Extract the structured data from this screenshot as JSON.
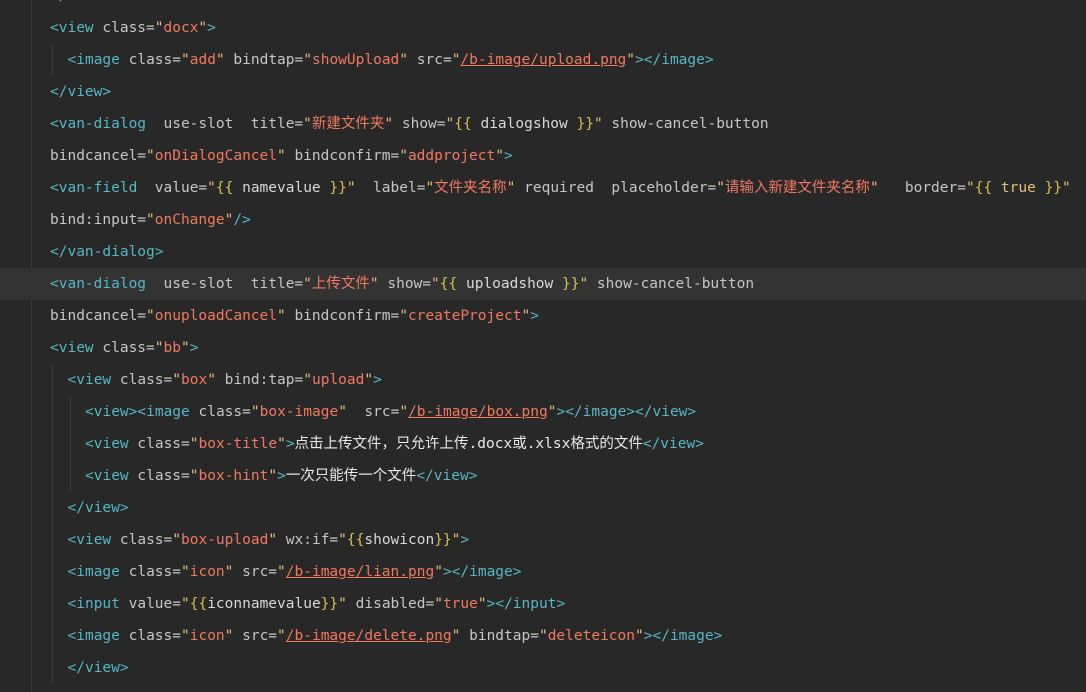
{
  "lines": [
    {
      "indent": 1,
      "tokens": [
        [
          "tag",
          "</view>"
        ]
      ]
    },
    {
      "indent": 1,
      "tokens": [
        [
          "tag",
          "<view"
        ],
        [
          "attr",
          " class="
        ],
        [
          "str",
          "\""
        ],
        [
          "val",
          "docx"
        ],
        [
          "str",
          "\""
        ],
        [
          "tag",
          ">"
        ]
      ]
    },
    {
      "indent": 2,
      "tokens": [
        [
          "tag",
          "<image"
        ],
        [
          "attr",
          " class="
        ],
        [
          "str",
          "\""
        ],
        [
          "val",
          "add"
        ],
        [
          "str",
          "\""
        ],
        [
          "attr",
          " bindtap="
        ],
        [
          "str",
          "\""
        ],
        [
          "val",
          "showUpload"
        ],
        [
          "str",
          "\""
        ],
        [
          "attr",
          " src="
        ],
        [
          "str",
          "\""
        ],
        [
          "link",
          "/b-image/upload.png"
        ],
        [
          "str",
          "\""
        ],
        [
          "tag",
          "></image>"
        ]
      ]
    },
    {
      "indent": 1,
      "tokens": [
        [
          "tag",
          "</view>"
        ]
      ]
    },
    {
      "indent": 1,
      "tokens": [
        [
          "tag",
          "<van-dialog"
        ],
        [
          "attr",
          "  use-slot  title="
        ],
        [
          "str",
          "\""
        ],
        [
          "val",
          "新建文件夹"
        ],
        [
          "str",
          "\""
        ],
        [
          "attr",
          " show="
        ],
        [
          "str",
          "\""
        ],
        [
          "brace",
          "{{"
        ],
        [
          "plain",
          " dialogshow "
        ],
        [
          "brace",
          "}}"
        ],
        [
          "str",
          "\""
        ],
        [
          "attr",
          " show-cancel-button"
        ]
      ]
    },
    {
      "indent": 1,
      "tokens": [
        [
          "attr",
          "bindcancel="
        ],
        [
          "str",
          "\""
        ],
        [
          "val",
          "onDialogCancel"
        ],
        [
          "str",
          "\""
        ],
        [
          "attr",
          " bindconfirm="
        ],
        [
          "str",
          "\""
        ],
        [
          "val",
          "addproject"
        ],
        [
          "str",
          "\""
        ],
        [
          "tag",
          ">"
        ]
      ]
    },
    {
      "indent": 1,
      "tokens": [
        [
          "tag",
          "<van-field"
        ],
        [
          "attr",
          "  value="
        ],
        [
          "str",
          "\""
        ],
        [
          "brace",
          "{{"
        ],
        [
          "plain",
          " namevalue "
        ],
        [
          "brace",
          "}}"
        ],
        [
          "str",
          "\""
        ],
        [
          "attr",
          "  label="
        ],
        [
          "str",
          "\""
        ],
        [
          "val",
          "文件夹名称"
        ],
        [
          "str",
          "\""
        ],
        [
          "attr",
          " required  placeholder="
        ],
        [
          "str",
          "\""
        ],
        [
          "val",
          "请输入新建文件夹名称"
        ],
        [
          "str",
          "\""
        ],
        [
          "attr",
          "   border="
        ],
        [
          "str",
          "\""
        ],
        [
          "brace",
          "{{"
        ],
        [
          "kw",
          " true "
        ],
        [
          "brace",
          "}}"
        ],
        [
          "str",
          "\""
        ]
      ]
    },
    {
      "indent": 1,
      "tokens": [
        [
          "attr",
          "bind:input="
        ],
        [
          "str",
          "\""
        ],
        [
          "val",
          "onChange"
        ],
        [
          "str",
          "\""
        ],
        [
          "tag",
          "/>"
        ]
      ]
    },
    {
      "indent": 1,
      "tokens": [
        [
          "tag",
          "</van-dialog>"
        ]
      ]
    },
    {
      "indent": 1,
      "highlight": true,
      "tokens": [
        [
          "tag",
          "<van-dialog"
        ],
        [
          "attr",
          "  use-slot  title="
        ],
        [
          "str",
          "\""
        ],
        [
          "val",
          "上传文件"
        ],
        [
          "str",
          "\""
        ],
        [
          "attr",
          " show="
        ],
        [
          "str",
          "\""
        ],
        [
          "brace",
          "{{"
        ],
        [
          "plain",
          " uploadshow "
        ],
        [
          "brace",
          "}}"
        ],
        [
          "str",
          "\""
        ],
        [
          "attr",
          " show-cancel-button"
        ]
      ]
    },
    {
      "indent": 1,
      "tokens": [
        [
          "attr",
          "bindcancel="
        ],
        [
          "str",
          "\""
        ],
        [
          "val",
          "onuploadCancel"
        ],
        [
          "str",
          "\""
        ],
        [
          "attr",
          " bindconfirm="
        ],
        [
          "str",
          "\""
        ],
        [
          "val",
          "createProject"
        ],
        [
          "str",
          "\""
        ],
        [
          "tag",
          ">"
        ]
      ]
    },
    {
      "indent": 1,
      "tokens": [
        [
          "tag",
          "<view"
        ],
        [
          "attr",
          " class="
        ],
        [
          "str",
          "\""
        ],
        [
          "val",
          "bb"
        ],
        [
          "str",
          "\""
        ],
        [
          "tag",
          ">"
        ]
      ]
    },
    {
      "indent": 2,
      "tokens": [
        [
          "tag",
          "<view"
        ],
        [
          "attr",
          " class="
        ],
        [
          "str",
          "\""
        ],
        [
          "val",
          "box"
        ],
        [
          "str",
          "\""
        ],
        [
          "attr",
          " bind:tap="
        ],
        [
          "str",
          "\""
        ],
        [
          "val",
          "upload"
        ],
        [
          "str",
          "\""
        ],
        [
          "tag",
          ">"
        ]
      ]
    },
    {
      "indent": 3,
      "tokens": [
        [
          "tag",
          "<view><image"
        ],
        [
          "attr",
          " class="
        ],
        [
          "str",
          "\""
        ],
        [
          "val",
          "box-image"
        ],
        [
          "str",
          "\""
        ],
        [
          "attr",
          "  src="
        ],
        [
          "str",
          "\""
        ],
        [
          "link",
          "/b-image/box.png"
        ],
        [
          "str",
          "\""
        ],
        [
          "tag",
          "></image></view>"
        ]
      ]
    },
    {
      "indent": 3,
      "tokens": [
        [
          "tag",
          "<view"
        ],
        [
          "attr",
          " class="
        ],
        [
          "str",
          "\""
        ],
        [
          "val",
          "box-title"
        ],
        [
          "str",
          "\""
        ],
        [
          "tag",
          ">"
        ],
        [
          "ctext",
          "点击上传文件，只允许上传.docx或.xlsx格式的文件"
        ],
        [
          "tag",
          "</view>"
        ]
      ]
    },
    {
      "indent": 3,
      "tokens": [
        [
          "tag",
          "<view"
        ],
        [
          "attr",
          " class="
        ],
        [
          "str",
          "\""
        ],
        [
          "val",
          "box-hint"
        ],
        [
          "str",
          "\""
        ],
        [
          "tag",
          ">"
        ],
        [
          "ctext",
          "一次只能传一个文件"
        ],
        [
          "tag",
          "</view>"
        ]
      ]
    },
    {
      "indent": 2,
      "tokens": [
        [
          "tag",
          "</view>"
        ]
      ]
    },
    {
      "indent": 2,
      "tokens": [
        [
          "tag",
          "<view"
        ],
        [
          "attr",
          " class="
        ],
        [
          "str",
          "\""
        ],
        [
          "val",
          "box-upload"
        ],
        [
          "str",
          "\""
        ],
        [
          "attr",
          " wx:if="
        ],
        [
          "str",
          "\""
        ],
        [
          "brace",
          "{{"
        ],
        [
          "plain",
          "showicon"
        ],
        [
          "brace",
          "}}"
        ],
        [
          "str",
          "\""
        ],
        [
          "tag",
          ">"
        ]
      ]
    },
    {
      "indent": 2,
      "tokens": [
        [
          "tag",
          "<image"
        ],
        [
          "attr",
          " class="
        ],
        [
          "str",
          "\""
        ],
        [
          "val",
          "icon"
        ],
        [
          "str",
          "\""
        ],
        [
          "attr",
          " src="
        ],
        [
          "str",
          "\""
        ],
        [
          "link",
          "/b-image/lian.png"
        ],
        [
          "str",
          "\""
        ],
        [
          "tag",
          "></image>"
        ]
      ]
    },
    {
      "indent": 2,
      "tokens": [
        [
          "tag",
          "<input"
        ],
        [
          "attr",
          " value="
        ],
        [
          "str",
          "\""
        ],
        [
          "brace",
          "{{"
        ],
        [
          "plain",
          "iconnamevalue"
        ],
        [
          "brace",
          "}}"
        ],
        [
          "str",
          "\""
        ],
        [
          "attr",
          " disabled="
        ],
        [
          "str",
          "\""
        ],
        [
          "val",
          "true"
        ],
        [
          "str",
          "\""
        ],
        [
          "tag",
          "></input>"
        ]
      ]
    },
    {
      "indent": 2,
      "tokens": [
        [
          "tag",
          "<image"
        ],
        [
          "attr",
          " class="
        ],
        [
          "str",
          "\""
        ],
        [
          "val",
          "icon"
        ],
        [
          "str",
          "\""
        ],
        [
          "attr",
          " src="
        ],
        [
          "str",
          "\""
        ],
        [
          "link",
          "/b-image/delete.png"
        ],
        [
          "str",
          "\""
        ],
        [
          "attr",
          " bindtap="
        ],
        [
          "str",
          "\""
        ],
        [
          "val",
          "deleteicon"
        ],
        [
          "str",
          "\""
        ],
        [
          "tag",
          "></image>"
        ]
      ]
    },
    {
      "indent": 2,
      "tokens": [
        [
          "tag",
          "</view>"
        ]
      ]
    }
  ]
}
